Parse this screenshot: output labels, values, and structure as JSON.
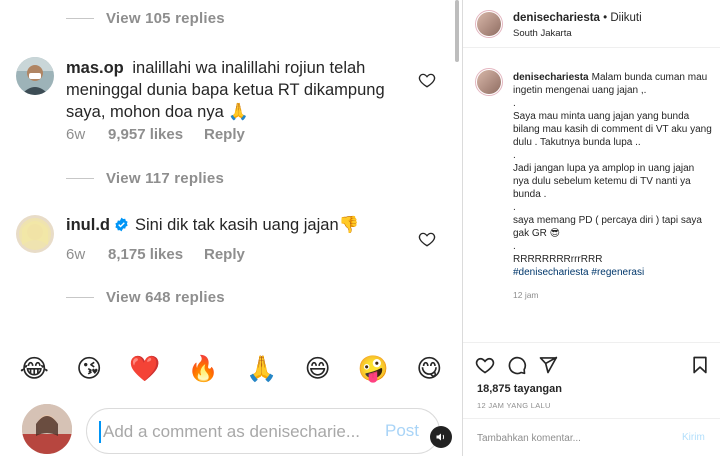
{
  "comment_view": {
    "view_replies": [
      "View 105 replies",
      "View 117 replies",
      "View 648 replies"
    ],
    "comments": [
      {
        "username": "mas.op",
        "text": "inalillahi wa inalillahi rojiun telah meninggal dunia bapa ketua RT dikampung saya, mohon doa nya 🙏",
        "time": "6w",
        "likes": "9,957 likes",
        "reply": "Reply",
        "verified": false
      },
      {
        "username": "inul.d",
        "text": "Sini dik tak kasih uang jajan👎",
        "time": "6w",
        "likes": "8,175 likes",
        "reply": "Reply",
        "verified": true
      }
    ],
    "emoji_reactions": [
      "😂",
      "😘",
      "❤️",
      "🔥",
      "🙏",
      "😄",
      "🤪",
      "😋"
    ],
    "composer": {
      "placeholder": "Add a comment as denisecharie...",
      "post_label": "Post"
    },
    "icons": {
      "like": "heart-outline-icon",
      "verified": "verified-badge-icon",
      "voice": "speaker-icon"
    }
  },
  "post_panel": {
    "header": {
      "username": "denisechariesta",
      "follow_status": " • Diikuti",
      "location": "South Jakarta"
    },
    "caption": {
      "username": "denisechariesta",
      "lines": [
        "Malam bunda cuman mau ingetin mengenai uang jajan ,.",
        ".",
        "Saya mau minta uang jajan yang bunda bilang mau kasih di comment di VT aku yang dulu . Takutnya bunda lupa ..",
        ".",
        "Jadi jangan lupa ya amplop in uang jajan nya dulu sebelum ketemu di TV nanti ya bunda .",
        ".",
        "saya memang PD ( percaya diri ) tapi saya gak GR 😎",
        ".",
        "RRRRRRRRrrrRRR"
      ],
      "hashtags": "#denisechariesta #regenerasi",
      "time": "12 jam"
    },
    "views": "18,875 tayangan",
    "posted_ago": "12 JAM YANG LALU",
    "comment_box": {
      "placeholder": "Tambahkan komentar...",
      "send_label": "Kirim"
    },
    "colors": {
      "link": "#00376b",
      "post_disabled": "#a9d4f7",
      "send_disabled": "#b2dffc",
      "verified": "#0095f6"
    }
  }
}
